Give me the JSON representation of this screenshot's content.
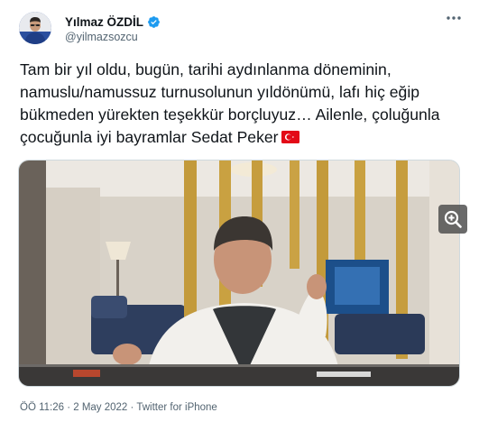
{
  "tweet": {
    "author": {
      "display_name": "Yılmaz ÖZDİL",
      "handle": "@yilmazsozcu",
      "verified_icon": "verified-badge-icon",
      "avatar_icon": "avatar"
    },
    "text": "Tam bir yıl oldu, bugün, tarihi aydınlanma döneminin, namuslu/namussuz turnusolunun yıldönümü, lafı hiç eğip bükmeden yürekten teşekkür borçluyuz… Ailenle, çoluğunla çocuğunla iyi bayramlar Sedat Peker",
    "flag_icon": "turkey-flag-icon",
    "more_icon": "more-options-icon",
    "zoom_icon": "zoom-in-icon",
    "timestamp": "ÖÖ 11:26 · 2 May 2022 · Twitter for iPhone"
  },
  "colors": {
    "text": "#0f1419",
    "secondary": "#536471",
    "verified": "#1d9bf0",
    "border": "#cfd9de"
  }
}
